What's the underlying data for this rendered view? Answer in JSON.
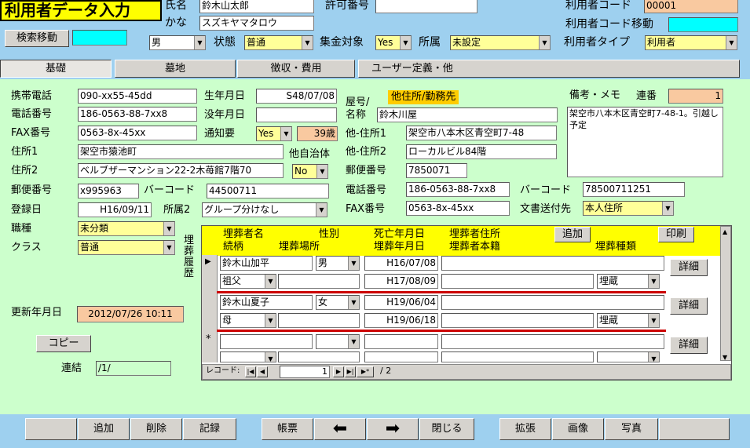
{
  "header": {
    "title": "利用者データ入力",
    "name_label": "氏名",
    "name_value": "鈴木山太郎",
    "kana_label": "かな",
    "kana_value": "スズキヤマタロウ",
    "permit_label": "許可番号",
    "permit_value": "",
    "user_code_label": "利用者コード",
    "user_code_value": "00001",
    "user_code_move_label": "利用者コード移動",
    "user_code_move_value": "",
    "search_move_button": "検索移動",
    "search_move_value": "",
    "gender_value": "男",
    "status_label": "状態",
    "status_value": "普通",
    "collect_label": "集金対象",
    "collect_value": "Yes",
    "affil_label": "所属",
    "affil_value": "未設定",
    "user_type_label": "利用者タイプ",
    "user_type_value": "利用者"
  },
  "tabs": [
    "基礎",
    "墓地",
    "徴収・費用",
    "ユーザー定義・他"
  ],
  "left": {
    "mobile_label": "携帯電話",
    "mobile_value": "090-xx55-45dd",
    "phone_label": "電話番号",
    "phone_value": "186-0563-88-7xx8",
    "fax_label": "FAX番号",
    "fax_value": "0563-8x-45xx",
    "addr1_label": "住所1",
    "addr1_value": "架空市猿池町",
    "addr2_label": "住所2",
    "addr2_value": "ベルブザーマンション22-2木苺館7階70",
    "zip_label": "郵便番号",
    "zip_value": "x995963",
    "barcode_label": "バーコード",
    "barcode_value": "44500711",
    "reg_label": "登録日",
    "reg_value": "H16/09/11",
    "affil2_label": "所属2",
    "affil2_value": "グループ分けなし",
    "job_label": "職種",
    "job_value": "未分類",
    "class_label": "クラス",
    "class_value": "普通",
    "birth_label": "生年月日",
    "birth_value": "S48/07/08",
    "death_label": "没年月日",
    "death_value": "",
    "notify_label": "通知要",
    "notify_value": "Yes",
    "age_value": "39歳",
    "other_city_label": "他自治体",
    "other_city_value": "No",
    "update_label": "更新年月日",
    "update_value": "2012/07/26 10:11",
    "copy_button": "コピー",
    "link_label": "連結",
    "link_value": "/1/"
  },
  "shop": {
    "yago_label": "屋号/",
    "name_label": "名称",
    "tag": "他住所/勤務先",
    "name_value": "鈴木川屋",
    "addr1_label": "他-住所1",
    "addr1_value": "架空市八本木区青空町7-48",
    "addr2_label": "他-住所2",
    "addr2_value": "ローカルビル84階",
    "zip_label": "郵便番号",
    "zip_value": "7850071",
    "phone_label": "電話番号",
    "phone_value": "186-0563-88-7xx8",
    "barcode_label": "バーコード",
    "barcode_value": "78500711251",
    "fax_label": "FAX番号",
    "fax_value": "0563-8x-45xx",
    "doc_label": "文書送付先",
    "doc_value": "本人住所"
  },
  "memo": {
    "label": "備考・メモ",
    "serial_label": "連番",
    "serial_value": "1",
    "text": "架空市八本木区青空町7-48-1。引越し予定"
  },
  "burial": {
    "side_label": "埋葬履歴",
    "h_name": "埋葬者名",
    "h_gender": "性別",
    "h_deathdate": "死亡年月日",
    "h_addr": "埋葬者住所",
    "h_relation": "続柄",
    "h_place": "埋葬場所",
    "h_burialdate": "埋葬年月日",
    "h_domicile": "埋葬者本籍",
    "h_type": "埋葬種類",
    "add_button": "追加",
    "print_button": "印刷",
    "detail_button": "詳細",
    "rows": [
      {
        "name": "鈴木山加平",
        "gender": "男",
        "death": "H16/07/08",
        "relation": "祖父",
        "burial": "H17/08/09",
        "type": "埋蔵"
      },
      {
        "name": "鈴木山夏子",
        "gender": "女",
        "death": "H19/06/04",
        "relation": "母",
        "burial": "H19/06/18",
        "type": "埋蔵"
      }
    ],
    "new_marker": "*",
    "record_label": "レコード:",
    "record_current": "1",
    "record_total": "/ 2"
  },
  "bottom": {
    "add": "追加",
    "delete": "削除",
    "save": "記録",
    "form": "帳票",
    "close": "閉じる",
    "expand": "拡張",
    "image": "画像",
    "photo": "写真"
  }
}
